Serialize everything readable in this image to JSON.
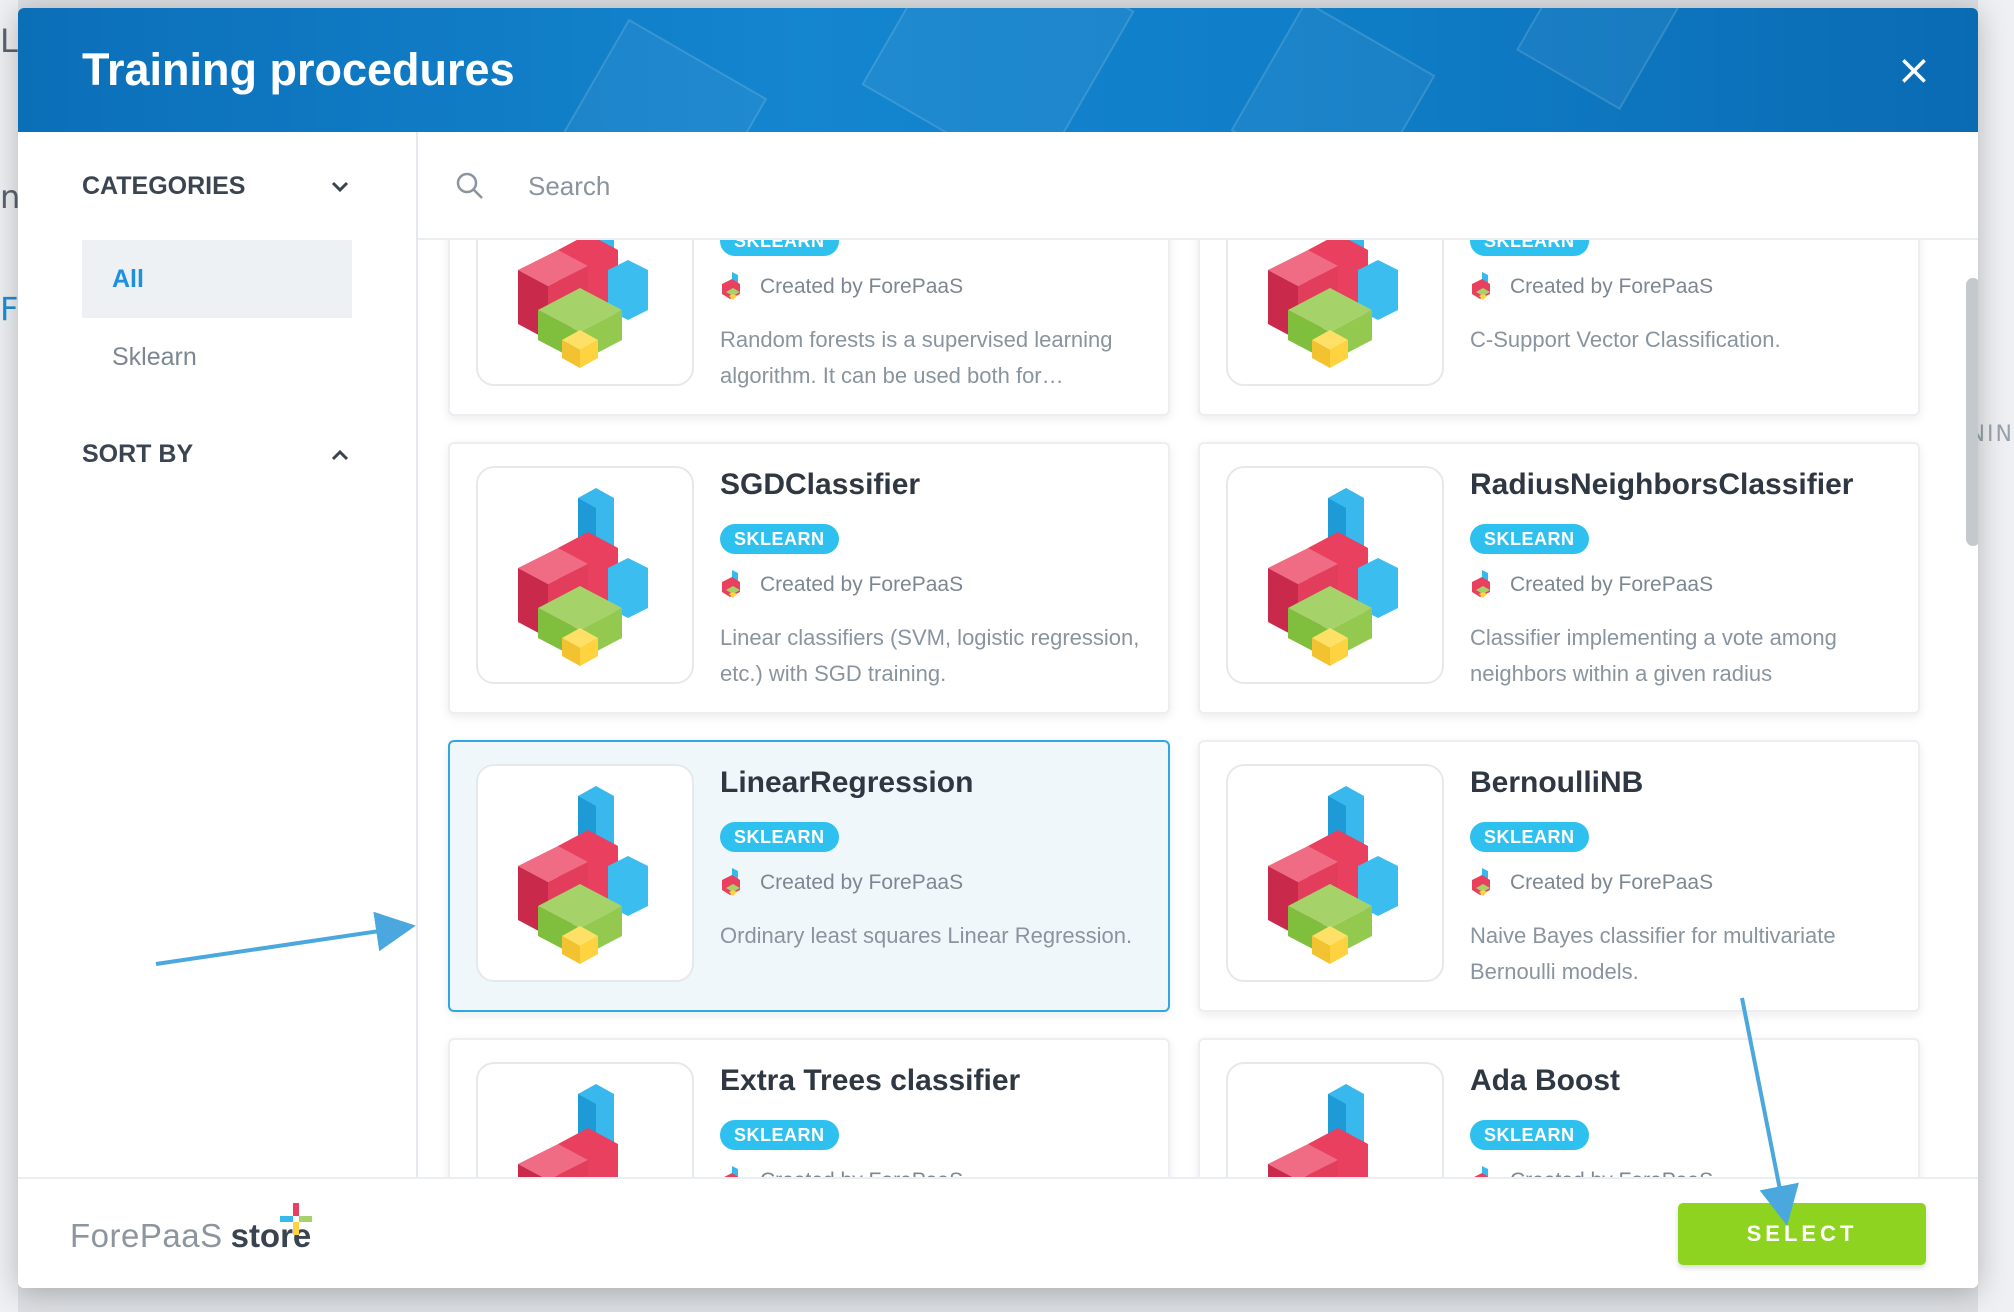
{
  "background": {
    "left_glyphs": [
      "Le",
      "ne",
      "FI"
    ],
    "right_text": "NIN"
  },
  "modal": {
    "title": "Training procedures",
    "close_icon": "close-icon"
  },
  "sidebar": {
    "categories_label": "CATEGORIES",
    "categories": [
      {
        "label": "All",
        "active": true
      },
      {
        "label": "Sklearn",
        "active": false
      }
    ],
    "sort_label": "SORT BY"
  },
  "search": {
    "placeholder": "Search",
    "value": ""
  },
  "cards": [
    {
      "title": "",
      "tag": "SKLEARN",
      "creator": "Created by ForePaaS",
      "description": "Random forests is a supervised learning algorithm. It can be used both for…",
      "selected": false
    },
    {
      "title": "",
      "tag": "SKLEARN",
      "creator": "Created by ForePaaS",
      "description": "C-Support Vector Classification.",
      "selected": false
    },
    {
      "title": "SGDClassifier",
      "tag": "SKLEARN",
      "creator": "Created by ForePaaS",
      "description": "Linear classifiers (SVM, logistic regression, etc.) with SGD training.",
      "selected": false
    },
    {
      "title": "RadiusNeighborsClassifier",
      "tag": "SKLEARN",
      "creator": "Created by ForePaaS",
      "description": "Classifier implementing a vote among neighbors within a given radius",
      "selected": false
    },
    {
      "title": "LinearRegression",
      "tag": "SKLEARN",
      "creator": "Created by ForePaaS",
      "description": "Ordinary least squares Linear Regression.",
      "selected": true
    },
    {
      "title": "BernoulliNB",
      "tag": "SKLEARN",
      "creator": "Created by ForePaaS",
      "description": "Naive Bayes classifier for multivariate Bernoulli models.",
      "selected": false
    },
    {
      "title": "Extra Trees classifier",
      "tag": "SKLEARN",
      "creator": "Created by ForePaaS",
      "description": "",
      "selected": false
    },
    {
      "title": "Ada Boost",
      "tag": "SKLEARN",
      "creator": "Created by ForePaaS",
      "description": "",
      "selected": false
    }
  ],
  "footer": {
    "brand": "ForePaaS",
    "store": "store",
    "select_label": "SELECT"
  },
  "colors": {
    "header_blue": "#1485cf",
    "accent_blue": "#1f8fe0",
    "badge_cyan": "#2ec1ef",
    "select_green": "#8ed31f",
    "annotation_arrow": "#4aa8de"
  }
}
